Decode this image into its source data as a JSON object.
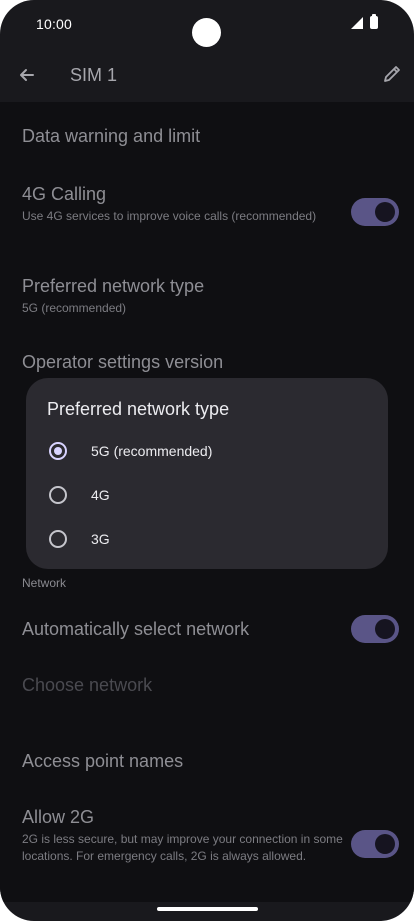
{
  "status_bar": {
    "time": "10:00"
  },
  "app_bar": {
    "title": "SIM 1"
  },
  "settings": {
    "data_warning": {
      "title": "Data warning and limit"
    },
    "calling": {
      "title": "4G Calling",
      "subtitle": "Use 4G services to improve voice calls (recommended)",
      "enabled": true
    },
    "preferred_network": {
      "title": "Preferred network type",
      "subtitle": "5G (recommended)"
    },
    "operator_version": {
      "title": "Operator settings version"
    },
    "network_section_label": "Network",
    "auto_select": {
      "title": "Automatically select network",
      "enabled": true
    },
    "choose_network": {
      "title": "Choose network"
    },
    "apn": {
      "title": "Access point names"
    },
    "allow_2g": {
      "title": "Allow 2G",
      "subtitle": "2G is less secure, but may improve your connection in some locations. For emergency calls, 2G is always allowed.",
      "enabled": true
    }
  },
  "dialog": {
    "title": "Preferred network type",
    "selected": "5G (recommended)",
    "options": [
      {
        "label": "5G (recommended)",
        "selected": true
      },
      {
        "label": "4G",
        "selected": false
      },
      {
        "label": "3G",
        "selected": false
      }
    ]
  },
  "colors": {
    "background": "#0f0f12",
    "dialog": "#2b2a30",
    "accent": "#d8d3ff",
    "toggle_track": "#5a5587"
  },
  "icons": [
    "arrow-back-icon",
    "pencil-icon",
    "signal-icon",
    "battery-icon"
  ]
}
